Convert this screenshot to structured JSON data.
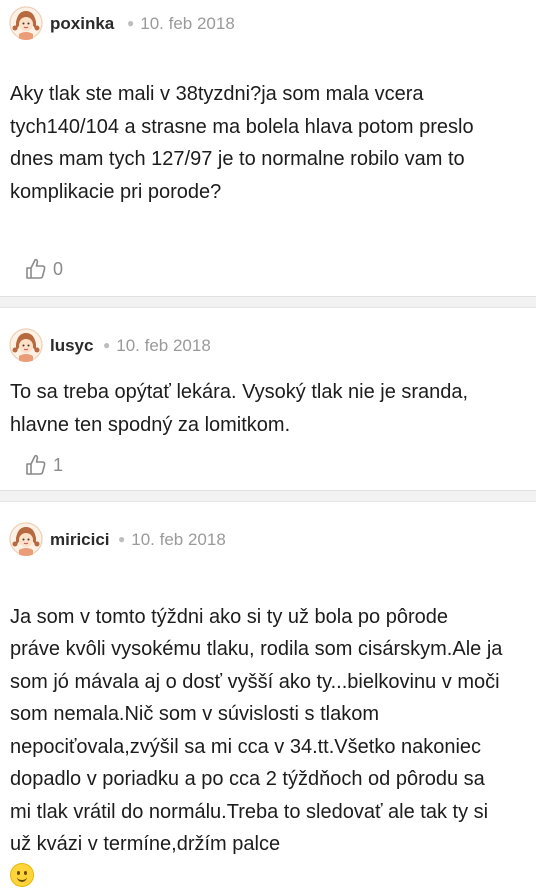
{
  "posts": [
    {
      "username": "poxinka",
      "date": "10. feb 2018",
      "text": "Aky tlak ste mali v 38tyzdni?ja som mala vcera\ntych140/104 a strasne ma bolela hlava potom preslo\ndnes mam tych 127/97 je to normalne robilo vam to\nkomplikacie pri porode?",
      "likes": "0"
    },
    {
      "username": "lusyc",
      "date": "10. feb 2018",
      "text": "To sa treba opýtať lekára. Vysoký tlak nie je sranda,\nhlavne ten spodný za lomitkom.",
      "likes": "1"
    },
    {
      "username": "miricici",
      "date": "10. feb 2018",
      "text": "Ja som v tomto týždni ako si ty už bola po pôrode\npráve kvôli vysokému tlaku, rodila som cisárskym.Ale ja\nsom jó mávala aj o dosť vyšší ako ty...bielkovinu v moči\nsom nemala.Nič som v súvislosti s tlakom\nnepociťovala,zvýšil sa mi cca v 34.tt.Všetko nakoniec\ndopadlo v poriadku a po cca 2 týždňoch od pôrodu sa\nmi tlak vrátil do normálu.Treba to sledovať ale tak ty si\nuž kvázi v termíne,držím palce",
      "emoji": "smiley-emoji"
    }
  ],
  "icons": {
    "avatar": "girl-avatar-icon",
    "like": "thumbs-up-icon"
  },
  "colors": {
    "meta": "#9a9a9a",
    "separator": "#f2f2f2"
  }
}
